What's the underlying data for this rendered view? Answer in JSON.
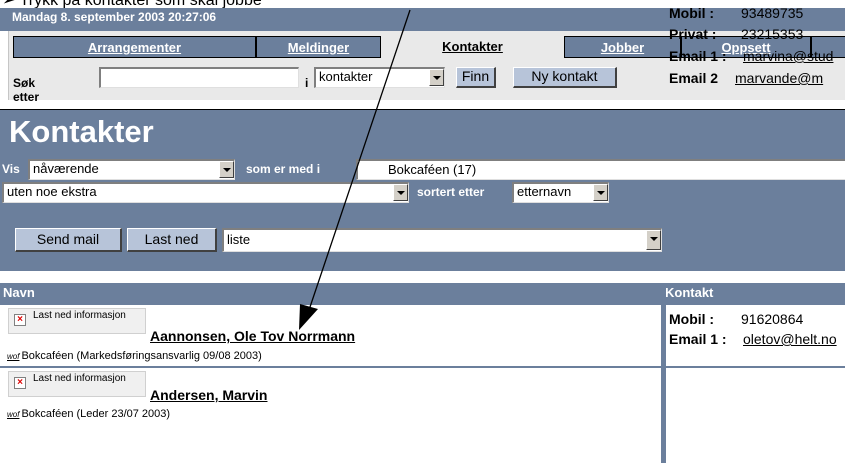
{
  "annotation": "➢ Trykk på kontakter som skal jobbe",
  "datetime": "Mandag 8. september 2003 20:27:06",
  "tabs": [
    {
      "label": "Arrangementer",
      "active": false
    },
    {
      "label": "Meldinger",
      "active": false
    },
    {
      "label": "Kontakter",
      "active": true
    },
    {
      "label": "Jobber",
      "active": false
    },
    {
      "label": "Oppsett",
      "active": false
    }
  ],
  "search": {
    "label": "Søk etter",
    "value": "",
    "in_label": "i",
    "scope": "kontakter",
    "find_button": "Finn",
    "new_contact_button": "Ny kontakt"
  },
  "panel": {
    "title": "Kontakter",
    "vis_label": "Vis",
    "vis_value": "nåværende",
    "member_label": "som er med i",
    "member_value": "Bokcaféen (17)",
    "extra_value": "uten noe ekstra",
    "sort_label": "sortert etter",
    "sort_value": "etternavn",
    "send_mail": "Send mail",
    "download": "Last ned",
    "format_value": "liste"
  },
  "table": {
    "col_name": "Navn",
    "col_contact": "Kontakt",
    "rows": [
      {
        "info": "Last ned informasjon",
        "name": "Aannonsen, Ole Tov Norrmann",
        "wof": "wof",
        "desc": "Bokcaféen (Markedsføringsansvarlig 09/08 2003)",
        "contacts": [
          {
            "label": "Mobil :",
            "value": "91620864",
            "link": false
          },
          {
            "label": "Email 1 :",
            "value": "oletov@helt.no",
            "link": true
          }
        ]
      },
      {
        "info": "Last ned informasjon",
        "name": "Andersen, Marvin",
        "wof": "wof",
        "desc": "Bokcaféen (Leder 23/07 2003)",
        "contacts": [
          {
            "label": "Mobil :",
            "value": "93489735",
            "link": false
          },
          {
            "label": "Privat :",
            "value": "23215353",
            "link": false
          },
          {
            "label": "Email 1 :",
            "value": "marvina@stud",
            "link": true
          },
          {
            "label": "Email 2",
            "value": "marvande@m",
            "link": true
          }
        ]
      }
    ]
  },
  "colors": {
    "header_blue": "#6b7f9c",
    "button_blue": "#b7c4d9",
    "frame_gray": "#e9e9e9"
  }
}
